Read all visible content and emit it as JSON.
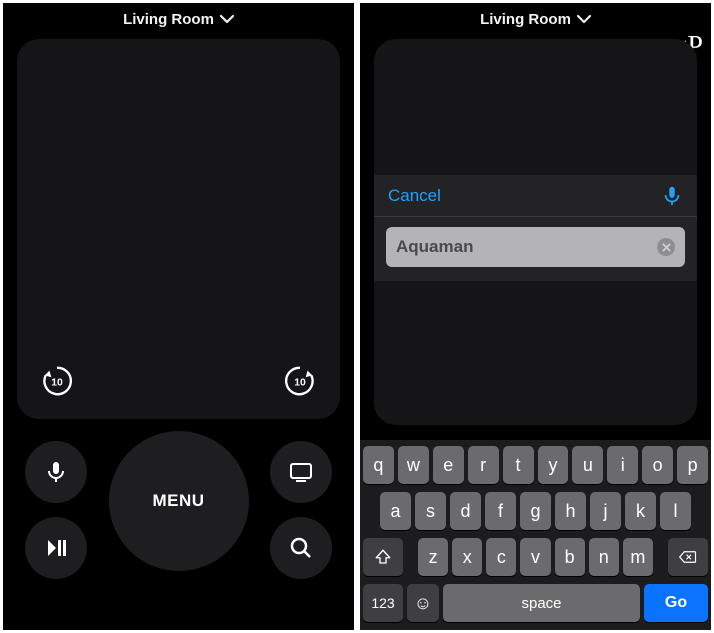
{
  "watermark": "gP",
  "left": {
    "device_label": "Living Room",
    "skip_back_seconds": "10",
    "skip_fwd_seconds": "10",
    "menu_label": "MENU"
  },
  "right": {
    "device_label": "Living Room",
    "cancel_label": "Cancel",
    "search_value": "Aquaman"
  },
  "keyboard": {
    "row1": [
      "q",
      "w",
      "e",
      "r",
      "t",
      "y",
      "u",
      "i",
      "o",
      "p"
    ],
    "row2": [
      "a",
      "s",
      "d",
      "f",
      "g",
      "h",
      "j",
      "k",
      "l"
    ],
    "row3": [
      "z",
      "x",
      "c",
      "v",
      "b",
      "n",
      "m"
    ],
    "numkey": "123",
    "space": "space",
    "go": "Go"
  }
}
